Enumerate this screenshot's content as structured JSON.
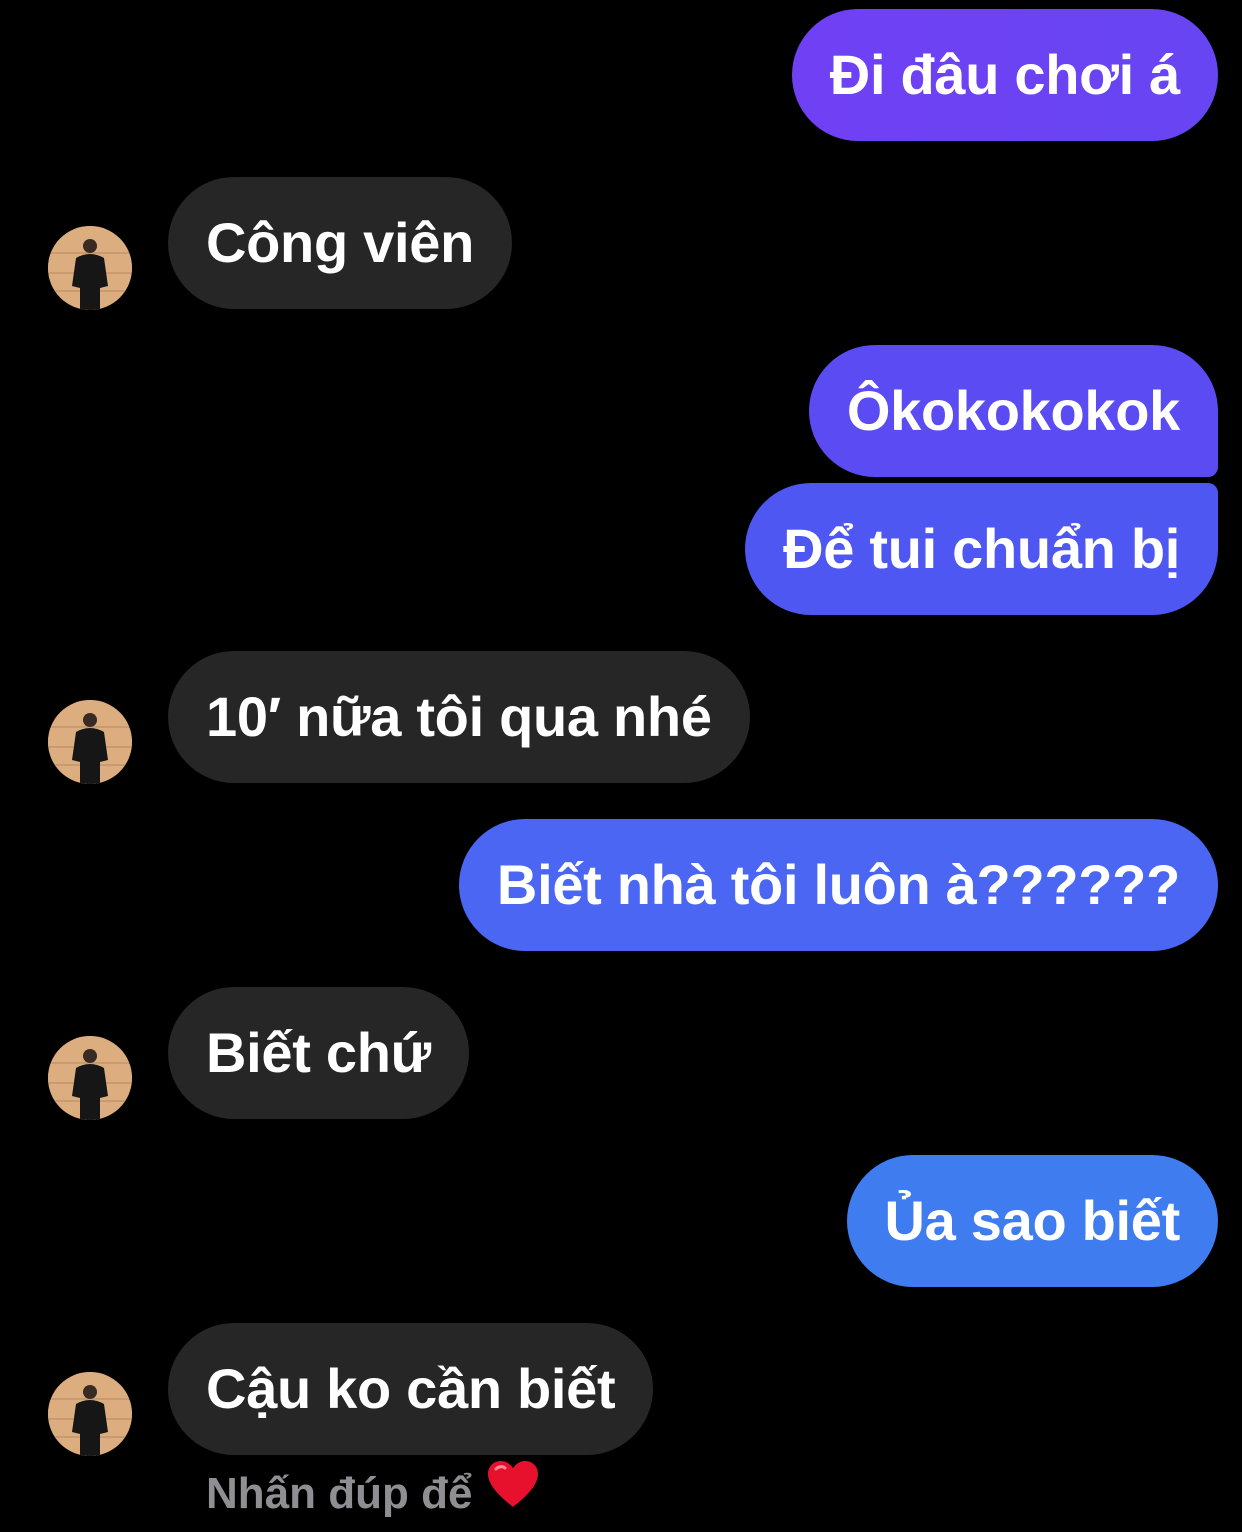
{
  "messages": [
    {
      "side": "sent",
      "text": "Đi đâu chơi á",
      "color": "#6a43f2"
    },
    {
      "side": "received",
      "text": "Công viên"
    },
    {
      "side": "sent",
      "text": "Ôkokokokok",
      "color": "#5a4df2"
    },
    {
      "side": "sent",
      "text": "Để tui chuẩn bị",
      "color": "#4e57f2"
    },
    {
      "side": "received",
      "text": "10′ nữa tôi qua nhé"
    },
    {
      "side": "sent",
      "text": "Biết nhà tôi luôn à??????",
      "color": "#4a66f2"
    },
    {
      "side": "received",
      "text": "Biết chứ"
    },
    {
      "side": "sent",
      "text": "Ủa sao biết",
      "color": "#3f7cf0"
    },
    {
      "side": "received",
      "text": "Cậu ko cần biết"
    }
  ],
  "hint": {
    "text": "Nhấn đúp để",
    "icon": "heart-icon"
  },
  "avatar": {
    "icon": "contact-avatar"
  }
}
